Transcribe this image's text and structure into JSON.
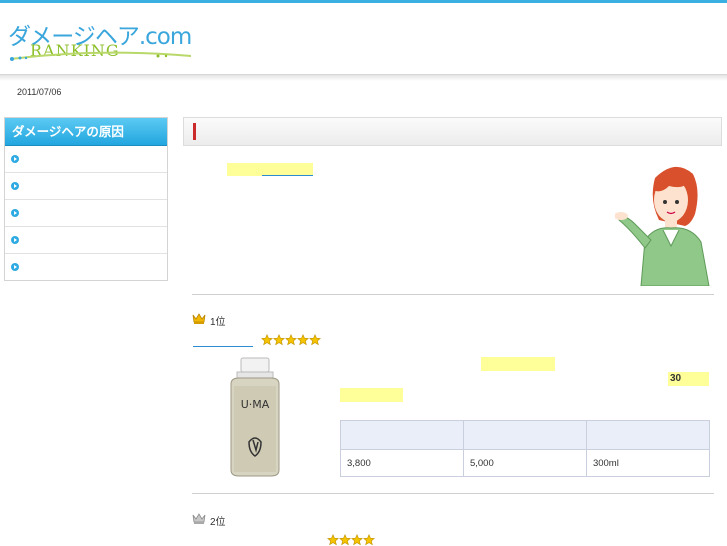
{
  "header": {
    "logo_text": "ダメージヘア.com",
    "logo_sub": "RANKING"
  },
  "date": "2011/07/06",
  "sidebar": {
    "title": "ダメージヘアの原因",
    "items": [
      {
        "label": ""
      },
      {
        "label": ""
      },
      {
        "label": ""
      },
      {
        "label": ""
      },
      {
        "label": ""
      }
    ]
  },
  "ranking": [
    {
      "rank": "1位",
      "stars": 5,
      "highlight_value": "30",
      "spec": {
        "headers": [
          "",
          "",
          ""
        ],
        "values": [
          "3,800",
          "5,000",
          "300ml"
        ]
      },
      "bottle_label": "U·MA"
    },
    {
      "rank": "2位",
      "stars": 4
    }
  ],
  "colors": {
    "accent": "#3ab0e2",
    "highlight": "#ffff99",
    "title_mark": "#cc2b2b",
    "star": "#f5c400"
  }
}
